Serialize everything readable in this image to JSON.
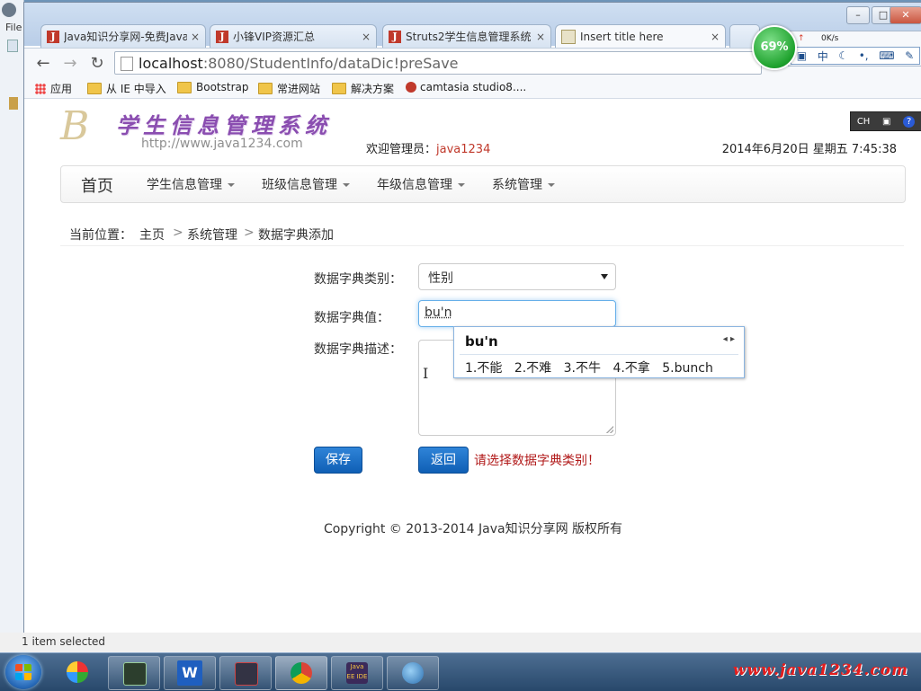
{
  "ide": {
    "menu_file": "File"
  },
  "browser": {
    "tabs": [
      {
        "label": "Java知识分享网-免费Java",
        "favicon": "J"
      },
      {
        "label": "小锋VIP资源汇总",
        "favicon": "J"
      },
      {
        "label": "Struts2学生信息管理系统",
        "favicon": "J"
      },
      {
        "label": "Insert title here",
        "favicon": ""
      }
    ],
    "close_glyph": "×",
    "url_host": "localhost",
    "url_rest": ":8080/StudentInfo/dataDic!preSave",
    "bookmarks": [
      "应用",
      "从 IE 中导入",
      "Bootstrap",
      "常进网站",
      "解决方案",
      "camtasia studio8...."
    ]
  },
  "site": {
    "logo_letter": "B",
    "title": "学生信息管理系统",
    "url": "http://www.java1234.com",
    "welcome_prefix": "欢迎管理员：",
    "username": "java1234",
    "datetime": "2014年6月20日 星期五 7:45:38",
    "nav": [
      {
        "label": "首页"
      },
      {
        "label": "学生信息管理"
      },
      {
        "label": "班级信息管理"
      },
      {
        "label": "年级信息管理"
      },
      {
        "label": "系统管理"
      }
    ],
    "breadcrumb": {
      "prefix": "当前位置：",
      "items": [
        "主页",
        "系统管理",
        "数据字典添加"
      ],
      "sep": ">"
    }
  },
  "form": {
    "category_label": "数据字典类别：",
    "category_value": "性别",
    "value_label": "数据字典值：",
    "value_text": "bu'n",
    "desc_label": "数据字典描述：",
    "save_label": "保存",
    "back_label": "返回",
    "error_text": "请选择数据字典类别！"
  },
  "ime_popup": {
    "composition": "bu'n",
    "candidates": [
      "1.不能",
      "2.不难",
      "3.不牛",
      "4.不拿",
      "5.bunch"
    ]
  },
  "ime_mini": {
    "label": "CH"
  },
  "perf_widget": {
    "percent": "69%",
    "speed": "0K/s",
    "ime_char": "中"
  },
  "footer": {
    "copyright": "Copyright © 2013-2014 Java知识分享网 版权所有"
  },
  "status": {
    "text": "1 item selected"
  },
  "taskbar": {
    "watermark": "www.java1234.com",
    "java_ee_label": "Java EE IDE"
  }
}
